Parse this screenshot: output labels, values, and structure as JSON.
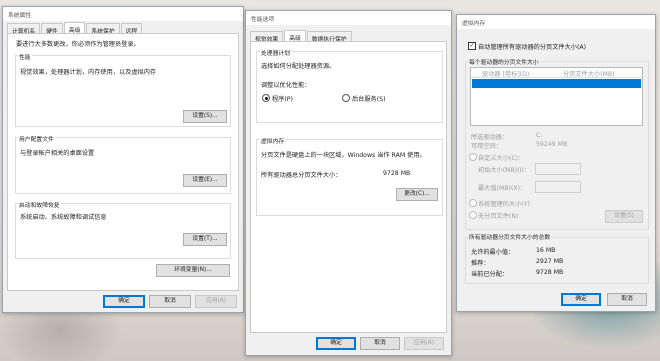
{
  "win1": {
    "title": "系统属性",
    "tabs": [
      "计算机名",
      "硬件",
      "高级",
      "系统保护",
      "远程"
    ],
    "notice": "要进行大多数更改，你必须作为管理员登录。",
    "perf": {
      "label": "性能",
      "desc": "视觉效果，处理器计划，内存使用，以及虚拟内存",
      "button": "设置(S)..."
    },
    "profile": {
      "label": "用户配置文件",
      "desc": "与登录帐户相关的桌面设置",
      "button": "设置(E)..."
    },
    "startup": {
      "label": "启动和故障恢复",
      "desc": "系统启动、系统故障和调试信息",
      "button": "设置(T)..."
    },
    "env_button": "环境变量(N)...",
    "ok": "确定",
    "cancel": "取消",
    "apply": "应用(A)"
  },
  "win2": {
    "title": "性能选项",
    "tabs": [
      "视觉效果",
      "高级",
      "数据执行保护"
    ],
    "sched": {
      "label": "处理器计划",
      "desc": "选择如何分配处理器资源。",
      "adjust": "调整以优化性能：",
      "opt1": "程序(P)",
      "opt2": "后台服务(S)"
    },
    "vm": {
      "label": "虚拟内存",
      "desc": "分页文件是硬盘上的一块区域，Windows 当作 RAM 使用。",
      "total_label": "所有驱动器总分页文件大小：",
      "total_value": "9728 MB",
      "button": "更改(C)..."
    },
    "ok": "确定",
    "cancel": "取消",
    "apply": "应用(A)"
  },
  "win3": {
    "title": "虚拟内存",
    "auto_label": "自动管理所有驱动器的分页文件大小(A)",
    "per_drive": "每个驱动器的分页文件大小",
    "col1": "驱动器 [卷标](D)",
    "col2": "分页文件大小(MB)",
    "sel_drive_label": "所选驱动器：",
    "sel_drive_value": "C:",
    "avail_label": "可用空间：",
    "avail_value": "59249 MB",
    "custom": "自定义大小(C)：",
    "init_label": "初始大小(MB)(I)：",
    "max_label": "最大值(MB)(X)：",
    "sys_managed": "系统管理的大小(Y)",
    "no_paging": "无分页文件(N)",
    "set_button": "设置(S)",
    "total_header": "所有驱动器分页文件大小的总数",
    "min_label": "允许的最小值：",
    "min_value": "16 MB",
    "rec_label": "推荐：",
    "rec_value": "2927 MB",
    "cur_label": "当前已分配：",
    "cur_value": "9728 MB",
    "ok": "确定",
    "cancel": "取消"
  }
}
